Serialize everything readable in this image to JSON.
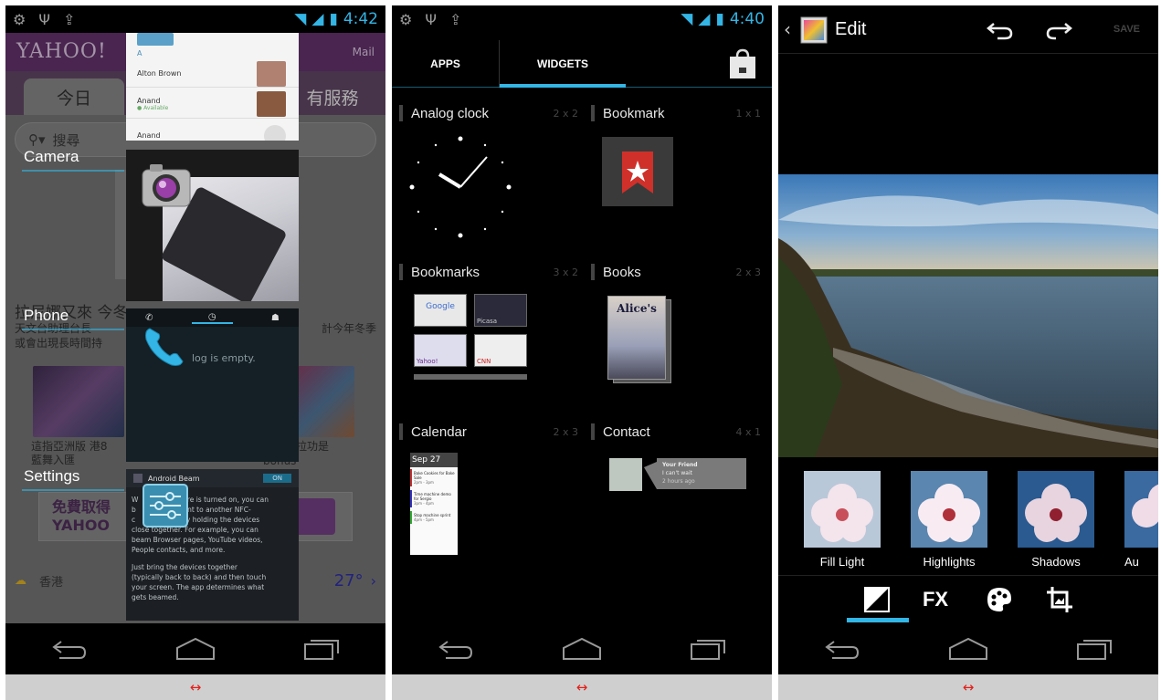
{
  "screen1": {
    "status": {
      "time": "4:42"
    },
    "yahoo": {
      "logo": "YAHOO!",
      "mail": "Mail",
      "tab_active": "今日",
      "tab_right": "有服務",
      "search": "搜尋",
      "news_title": "拉尼娜又來 今冬",
      "news_body_1": "天文台助理台長",
      "news_body_2": "或會出現長時間持",
      "news_body_right": "計今年冬季",
      "cap1_a": "這指亞洲版 港8",
      "cap1_b": "藍舞入匯",
      "cap2": "拉功是",
      "cap3": "bonus",
      "banner_a": "免費取得",
      "banner_b": "YAHOO",
      "weather_city": "香港",
      "weather_temp": "27°"
    },
    "recents": [
      {
        "label": "Camera"
      },
      {
        "label": "Phone"
      },
      {
        "label": "Settings"
      }
    ],
    "contacts": [
      {
        "name": "Alton Brown",
        "status": ""
      },
      {
        "name": "Anand",
        "status": "Available"
      },
      {
        "name": "Anand",
        "status": ""
      }
    ],
    "phone_log": "log is empty.",
    "settings_card": {
      "title": "Android Beam",
      "toggle": "ON",
      "text_1": "W",
      "text_2": "hare is turned on, you can",
      "text_3": "b",
      "text_4": "ntent to another NFC-",
      "text_5": "c",
      "text_6": "e by holding the devices",
      "text_7": "close together. For example, you can",
      "text_8": "beam Browser pages, YouTube videos,",
      "text_9": "People contacts, and more.",
      "text_10": "Just bring the devices together",
      "text_11": "(typically back to back) and then touch",
      "text_12": "your screen. The app determines what",
      "text_13": "gets beamed."
    }
  },
  "screen2": {
    "status": {
      "time": "4:40"
    },
    "tabs": [
      {
        "label": "APPS"
      },
      {
        "label": "WIDGETS"
      }
    ],
    "widgets": [
      {
        "name": "Analog clock",
        "size": "2 x 2"
      },
      {
        "name": "Bookmark",
        "size": "1 x 1"
      },
      {
        "name": "Bookmarks",
        "size": "3 x 2"
      },
      {
        "name": "Books",
        "size": "2 x 3"
      },
      {
        "name": "Calendar",
        "size": "2 x 3"
      },
      {
        "name": "Contact",
        "size": "4 x 1"
      }
    ],
    "books_title": "Alice's",
    "bookmark_thumbs": [
      "Google",
      "Picasa",
      "Yahoo!",
      "CNN"
    ],
    "calendar": {
      "date": "Sep 27",
      "events": [
        {
          "title": "Bake Cookies for Bake Sale",
          "time": "2pm - 3pm"
        },
        {
          "title": "Time machine demo for Sergio",
          "time": "3pm - 4pm"
        },
        {
          "title": "Stop machine sprint",
          "time": "4pm - 5pm"
        }
      ]
    },
    "contact_widget": {
      "name": "Your Friend",
      "line1": "I can't wait",
      "line2": "2 hours ago"
    }
  },
  "screen3": {
    "title": "Edit",
    "save": "SAVE",
    "filters": [
      {
        "label": "Fill Light"
      },
      {
        "label": "Highlights"
      },
      {
        "label": "Shadows"
      },
      {
        "label": "Au"
      }
    ],
    "tools": [
      {
        "label": "FX"
      }
    ],
    "accent": "#33b5e5"
  },
  "captions": [
    {
      "text": "↔"
    },
    {
      "text": "↔"
    },
    {
      "text": "↔"
    }
  ]
}
